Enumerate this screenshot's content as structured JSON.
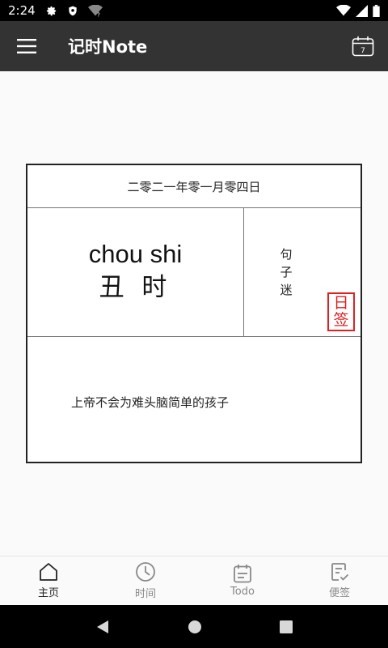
{
  "status_bar": {
    "time": "2:24"
  },
  "app_bar": {
    "title": "记时Note",
    "calendar_day": "7"
  },
  "card": {
    "date": "二零二一年零一月零四日",
    "pinyin": "chou shi",
    "hour_name": "丑 时",
    "side_text": "句子迷",
    "seal_top": "日",
    "seal_bottom": "签",
    "quote": "上帝不会为难头脑简单的孩子"
  },
  "bottom_nav": {
    "items": [
      {
        "label": "主页",
        "icon": "home-icon",
        "active": true
      },
      {
        "label": "时间",
        "icon": "clock-icon",
        "active": false
      },
      {
        "label": "Todo",
        "icon": "calendar-list-icon",
        "active": false
      },
      {
        "label": "便签",
        "icon": "note-check-icon",
        "active": false
      }
    ]
  },
  "colors": {
    "app_bar": "#333333",
    "seal": "#e02020",
    "background": "#fafafa"
  }
}
